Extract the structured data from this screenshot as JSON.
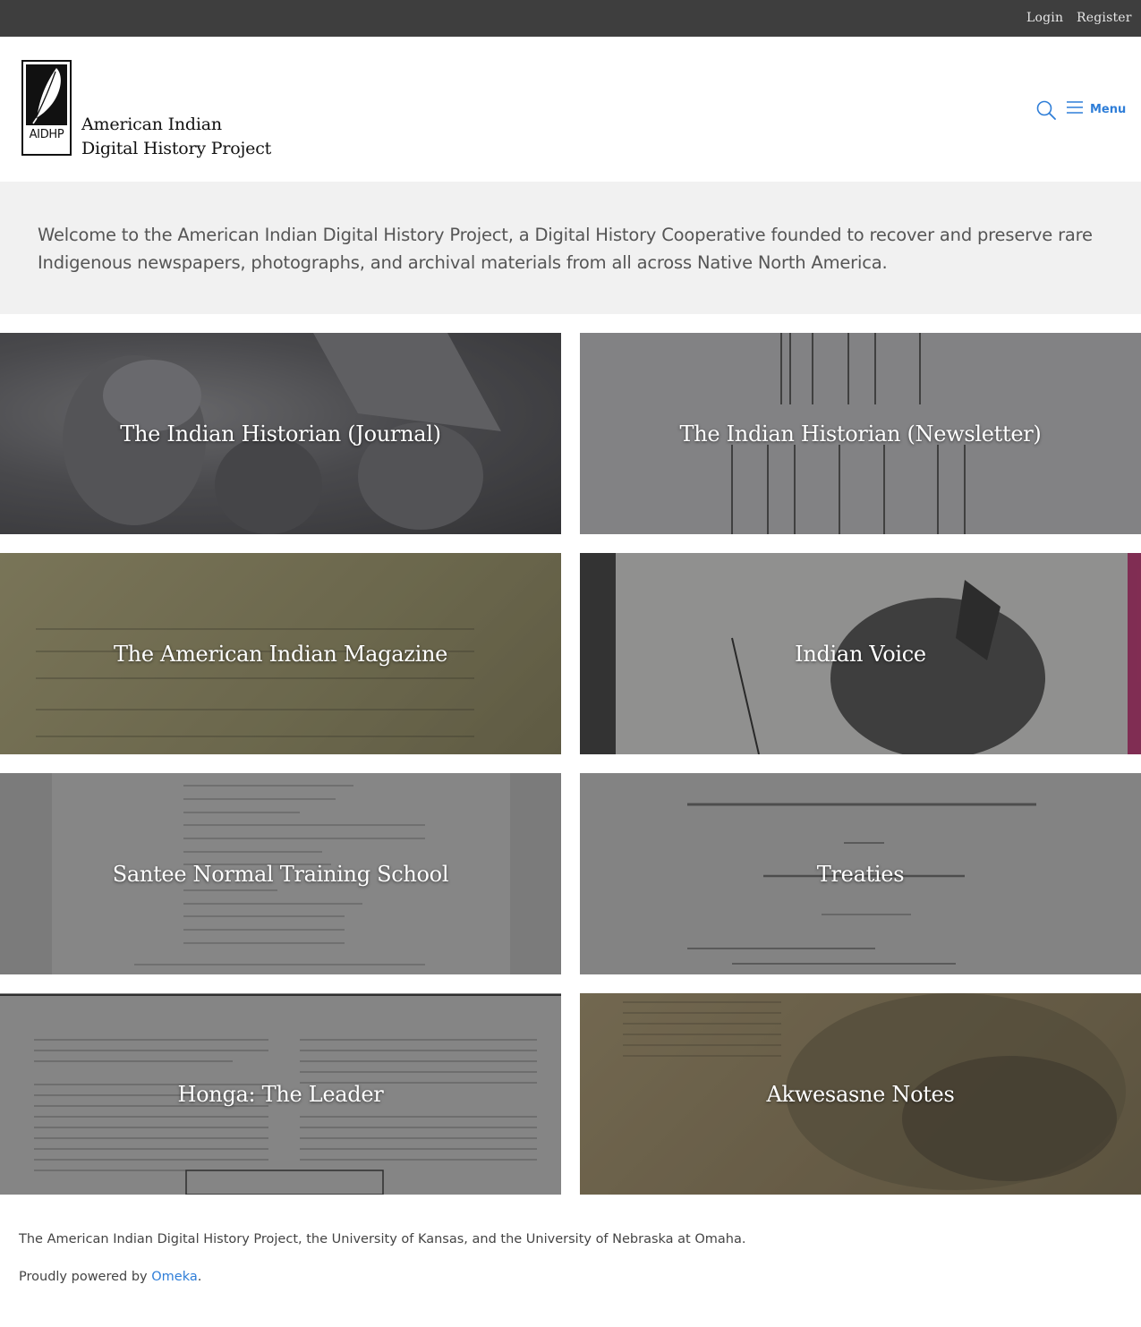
{
  "topbar": {
    "login": "Login",
    "register": "Register"
  },
  "header": {
    "logo_abbr": "AIDHP",
    "site_name_line1": "American Indian",
    "site_name_line2": "Digital History Project",
    "menu_label": "Menu"
  },
  "welcome": {
    "text": "Welcome to the American Indian Digital History Project, a Digital History Cooperative founded to recover and preserve rare Indigenous newspapers, photographs, and archival materials from all across Native North America."
  },
  "collections": [
    {
      "title": "The Indian Historian (Journal)"
    },
    {
      "title": "The Indian Historian (Newsletter)"
    },
    {
      "title": "The American Indian Magazine"
    },
    {
      "title": "Indian Voice"
    },
    {
      "title": "Santee Normal Training School"
    },
    {
      "title": "Treaties"
    },
    {
      "title": "Honga: The Leader"
    },
    {
      "title": "Akwesasne Notes"
    }
  ],
  "footer": {
    "credit": "The American Indian Digital History Project, the University of Kansas, and the University of Nebraska at Omaha.",
    "powered_prefix": "Proudly powered by ",
    "powered_link": "Omeka",
    "powered_suffix": "."
  },
  "colors": {
    "topbar": "#3e3e3e",
    "accent": "#2f7ed8",
    "welcome_bg": "#f1f1f1"
  },
  "icons": [
    "search-icon",
    "hamburger-icon",
    "feather-icon"
  ]
}
